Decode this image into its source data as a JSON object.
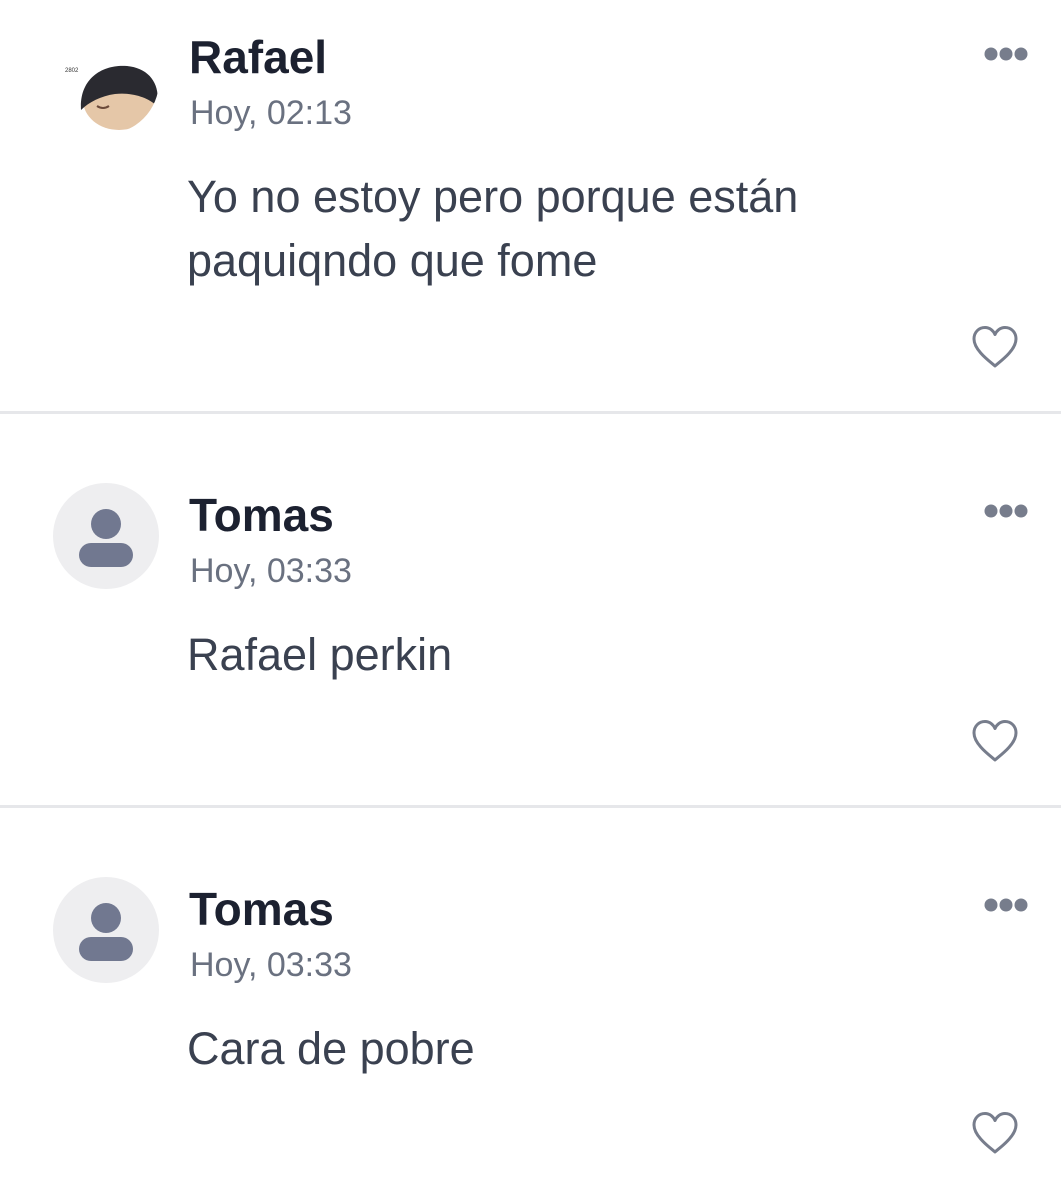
{
  "comments": [
    {
      "author": "Rafael",
      "time": "Hoy, 02:13",
      "text": "Yo no estoy pero porque están paquiqndo que fome",
      "avatar": "photo-avatar",
      "avatar_caption": "2802"
    },
    {
      "author": "Tomas",
      "time": "Hoy, 03:33",
      "text": "Rafael perkin",
      "avatar": "default-user-icon"
    },
    {
      "author": "Tomas",
      "time": "Hoy, 03:33",
      "text": "Cara de pobre",
      "avatar": "default-user-icon"
    }
  ],
  "icons": {
    "more": "more-options-icon",
    "like": "heart-icon"
  },
  "colors": {
    "author": "#1c2130",
    "time": "#6a7180",
    "text": "#3a4150",
    "icon": "#777d8c",
    "divider": "#e6e7ea",
    "avatar_bg": "#eeeef0"
  }
}
